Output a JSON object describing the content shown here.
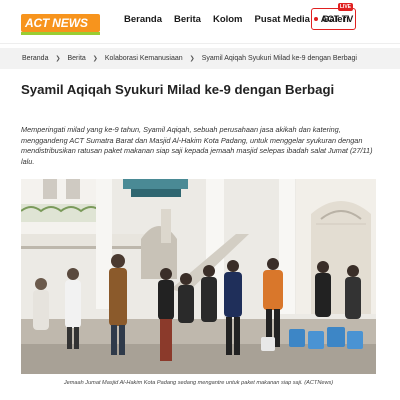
{
  "header": {
    "logo_part1": "ACT",
    "logo_part2": "NEWS",
    "nav": [
      "Beranda",
      "Berita",
      "Kolom",
      "Pusat Media",
      "Galeri"
    ],
    "tv_label": "ACT TV",
    "tv_badge": "LIVE"
  },
  "breadcrumb": [
    "Beranda",
    "Berita",
    "Kolaborasi Kemanusiaan",
    "Syamil Aqiqah Syukuri Milad ke-9 dengan Berbagi"
  ],
  "article": {
    "title": "Syamil Aqiqah Syukuri Milad ke-9 dengan Berbagi",
    "lead": "Memperingati milad yang ke-9 tahun, Syamil Aqiqah, sebuah perusahaan jasa akikah dan katering, menggandeng ACT Sumatra Barat dan Masjid Al-Hakim Kota Padang, untuk menggelar syukuran dengan mendistribusikan ratusan paket makanan siap saji kepada jemaah masjid selepas ibadah salat Jumat (27/11) lalu.",
    "photo_caption": "Jemaah Jumat Masjid Al-Hakim Kota Padang sedang mengantre untuk paket makanan siap saji. (ACTNews)"
  },
  "colors": {
    "brand_orange": "#f7941d",
    "brand_green": "#9acd32",
    "live_red": "#e02020"
  }
}
